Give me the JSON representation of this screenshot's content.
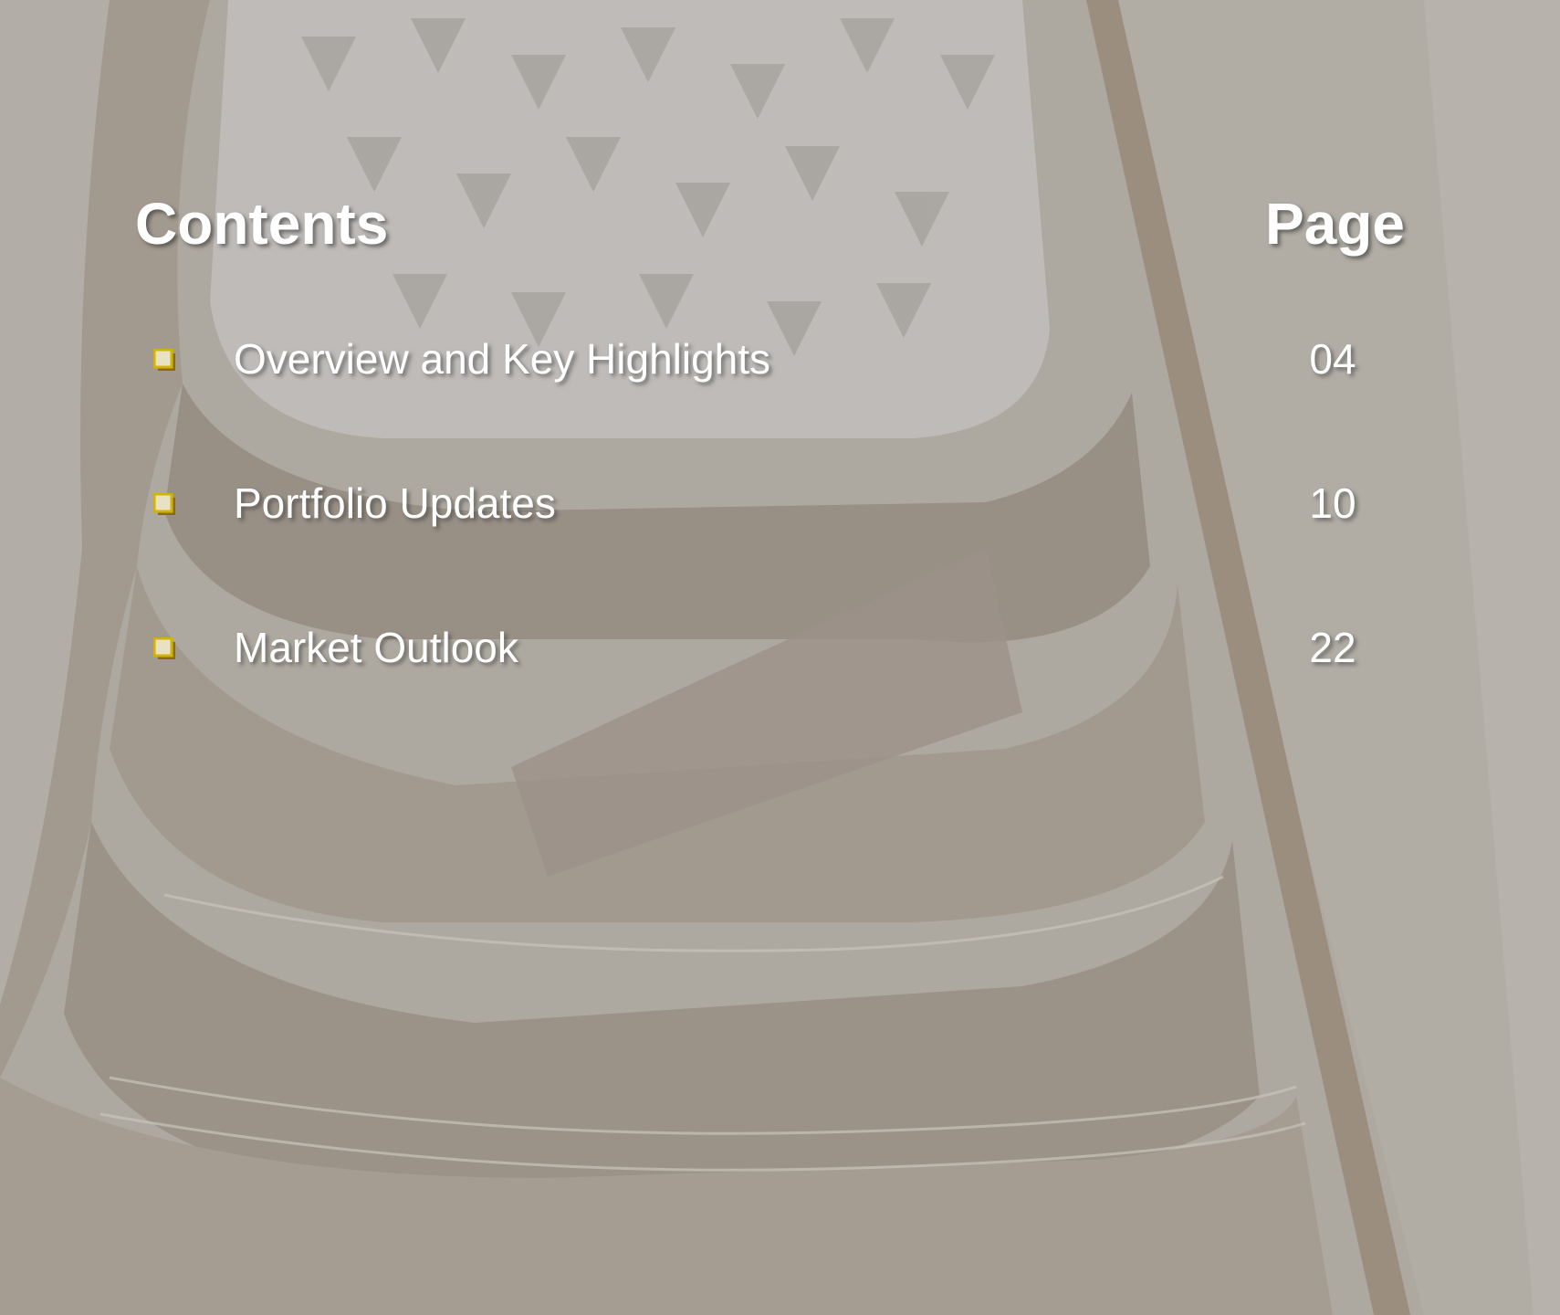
{
  "headings": {
    "contents": "Contents",
    "page": "Page"
  },
  "toc": [
    {
      "label": "Overview and Key Highlights",
      "page": "04"
    },
    {
      "label": "Portfolio Updates",
      "page": "10"
    },
    {
      "label": "Market Outlook",
      "page": "22"
    }
  ],
  "colors": {
    "bullet": "#d4b106",
    "text": "#ffffff"
  },
  "icons": {
    "bullet": "square-bullet-icon"
  }
}
